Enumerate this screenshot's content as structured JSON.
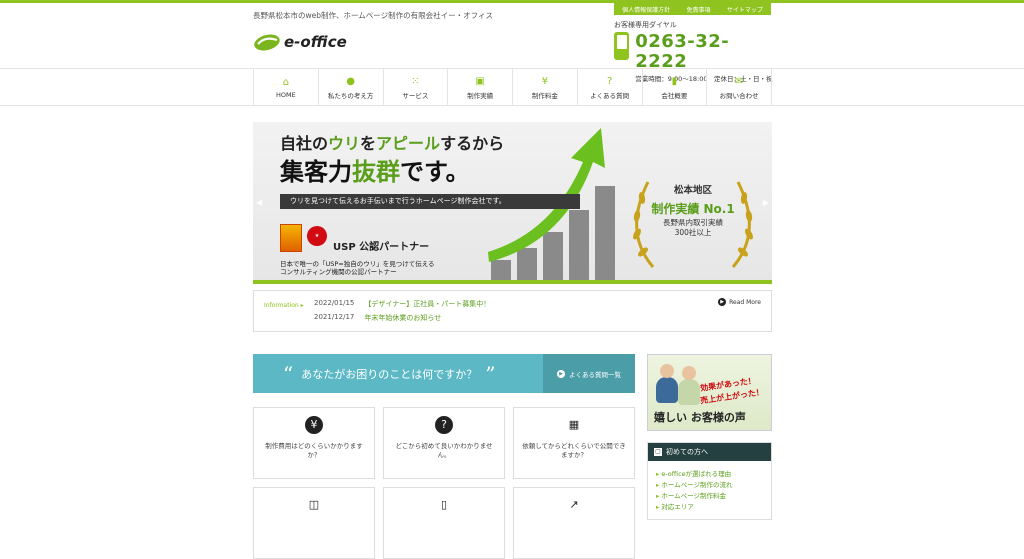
{
  "header": {
    "tagline": "長野県松本市のweb制作、ホームページ制作の有限会社イー・オフィス",
    "utility_links": [
      "個人情報保護方針",
      "免責事項",
      "サイトマップ"
    ],
    "logo_text": "e-office",
    "phone_caption": "お客様専用ダイヤル",
    "phone_number": "0263-32-2222",
    "phone_hours": "営業時間：9:00～18:00　定休日：土・日・祝"
  },
  "nav": {
    "items": [
      {
        "label": "HOME",
        "icon": "home-icon"
      },
      {
        "label": "私たちの考え方",
        "icon": "speech-icon"
      },
      {
        "label": "サービス",
        "icon": "grid-icon"
      },
      {
        "label": "制作実績",
        "icon": "monitor-icon"
      },
      {
        "label": "制作料金",
        "icon": "yen-icon"
      },
      {
        "label": "よくある質問",
        "icon": "question-icon"
      },
      {
        "label": "会社概要",
        "icon": "building-icon"
      },
      {
        "label": "お問い合わせ",
        "icon": "mail-icon"
      }
    ]
  },
  "hero": {
    "line1_a": "自社の",
    "line1_b": "ウリ",
    "line1_c": "を",
    "line1_d": "アピール",
    "line1_e": "するから",
    "line2_a": "集客力",
    "line2_b": "抜群",
    "line2_c": "です。",
    "band": "ウリを見つけて伝えるお手伝いまで行うホームページ制作会社です。",
    "usp_title": "USP 公認パートナー",
    "usp_desc_1": "日本で唯一の「USP=独自のウリ」を見つけて伝える",
    "usp_desc_2": "コンサルティング機関の公認パートナー",
    "badge_1": "松本地区",
    "badge_2": "制作実績 No.1",
    "badge_3": "長野県内取引実績",
    "badge_4": "300社以上",
    "prev_icon": "chevron-left-icon",
    "next_icon": "chevron-right-icon"
  },
  "info": {
    "label": "Information",
    "news": [
      {
        "date": "2022/01/15",
        "title": "【デザイナー】正社員・パート募集中！"
      },
      {
        "date": "2021/12/17",
        "title": "年末年始休業のお知らせ"
      }
    ],
    "read_more": "Read More"
  },
  "question": {
    "heading": "あなたがお困りのことは何ですか？",
    "faq_link": "よくある質問一覧"
  },
  "cards": [
    {
      "icon": "yen-icon",
      "text": "制作費用はどのくらいかかりますか？"
    },
    {
      "icon": "question-icon",
      "text": "どこから初めて良いかわかりません。"
    },
    {
      "icon": "calendar-icon",
      "text": "依頼してからどれくらいで公開できますか？"
    },
    {
      "icon": "browser-icon",
      "text": ""
    },
    {
      "icon": "smartphone-icon",
      "text": ""
    },
    {
      "icon": "chart-up-icon",
      "text": ""
    }
  ],
  "sidebar": {
    "voice_red_1": "効果があった！",
    "voice_red_2": "売上が上がった！",
    "voice_title": "嬉しい お客様の声",
    "beginner_title": "初めての方へ",
    "beginner_links": [
      "e-officeが選ばれる理由",
      "ホームページ制作の流れ",
      "ホームページ制作料金",
      "対応エリア"
    ]
  },
  "colors": {
    "accent": "#8fc31f",
    "accent_dark": "#5a9e1b",
    "teal": "#5bb8c4",
    "dark_teal": "#244040"
  }
}
